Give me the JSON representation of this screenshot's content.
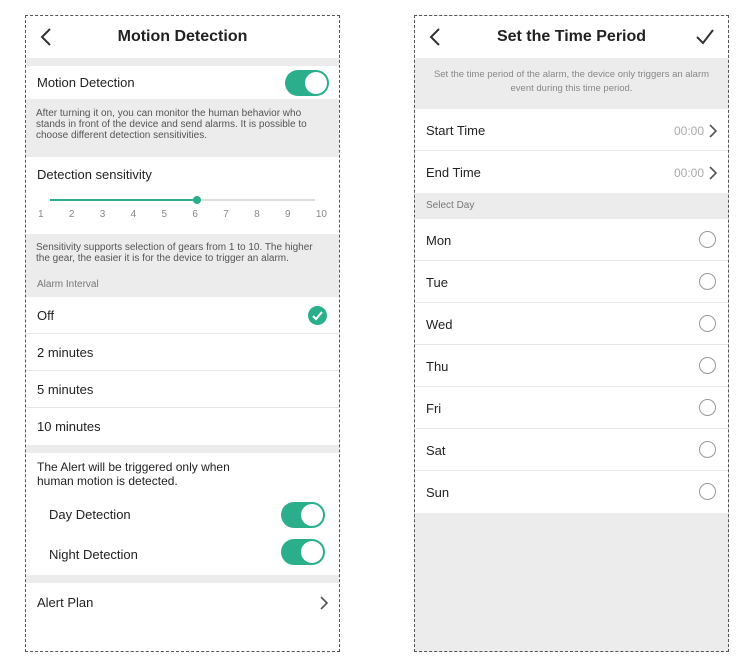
{
  "left_screen": {
    "title": "Motion Detection",
    "motion_detection": {
      "label": "Motion Detection",
      "enabled": true,
      "description": "After turning it on, you can monitor the human behavior who stands in front of the device and send alarms. It is possible to choose different detection sensitivities."
    },
    "sensitivity": {
      "label": "Detection sensitivity",
      "ticks": [
        "1",
        "2",
        "3",
        "4",
        "5",
        "6",
        "7",
        "8",
        "9",
        "10"
      ],
      "value": 6,
      "description": "Sensitivity supports selection of gears from 1 to 10. The higher the gear, the easier it is for the device to trigger an alarm."
    },
    "alarm_interval": {
      "header": "Alarm Interval",
      "options": [
        "Off",
        "2 minutes",
        "5 minutes",
        "10 minutes"
      ],
      "selected": "Off"
    },
    "alert_note": "The Alert will be triggered only when human motion is detected.",
    "day_detection": {
      "label": "Day Detection",
      "enabled": true
    },
    "night_detection": {
      "label": "Night Detection",
      "enabled": true
    },
    "alert_plan": {
      "label": "Alert Plan"
    },
    "accent_color": "#2bae8c"
  },
  "right_screen": {
    "title": "Set the Time Period",
    "description": "Set the time period of the alarm, the device only triggers an alarm event during this time period.",
    "start_time": {
      "label": "Start Time",
      "value": "00:00"
    },
    "end_time": {
      "label": "End Time",
      "value": "00:00"
    },
    "select_day_header": "Select Day",
    "days": [
      "Mon",
      "Tue",
      "Wed",
      "Thu",
      "Fri",
      "Sat",
      "Sun"
    ]
  }
}
